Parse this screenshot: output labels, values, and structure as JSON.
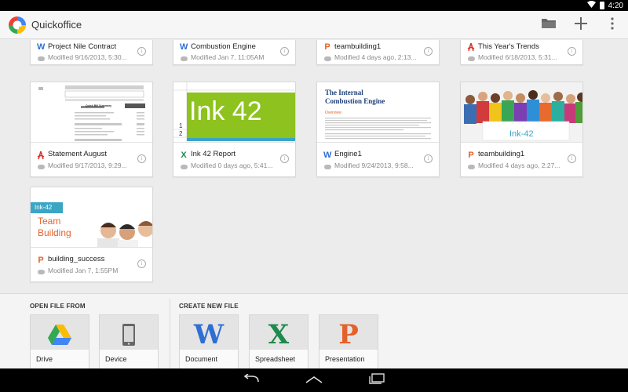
{
  "status": {
    "time": "4:20"
  },
  "app": {
    "title": "Quickoffice"
  },
  "files": [
    {
      "name": "Project Nile Contract",
      "modified": "Modified 9/16/2013, 5:30...",
      "type": "word",
      "glyph": "W"
    },
    {
      "name": "Combustion Engine",
      "modified": "Modified Jan 7, 11:05AM",
      "type": "word",
      "glyph": "W"
    },
    {
      "name": "teambuilding1",
      "modified": "Modified 4 days ago, 2:13...",
      "type": "slides",
      "glyph": "P"
    },
    {
      "name": "This Year's Trends",
      "modified": "Modified 6/18/2013, 5:31...",
      "type": "pdf",
      "glyph": "⅄"
    },
    {
      "name": "Statement August",
      "modified": "Modified 9/17/2013, 9:29...",
      "type": "pdf",
      "glyph": "⅄"
    },
    {
      "name": "Ink 42 Report",
      "modified": "Modified 0 days ago, 5:41...",
      "type": "sheet",
      "glyph": "X"
    },
    {
      "name": "Engine1",
      "modified": "Modified 9/24/2013, 9:58...",
      "type": "word",
      "glyph": "W"
    },
    {
      "name": "teambuilding1",
      "modified": "Modified 4 days ago, 2:27...",
      "type": "slides",
      "glyph": "P"
    },
    {
      "name": "building_success",
      "modified": "Modified Jan 7, 1:55PM",
      "type": "slides",
      "glyph": "P"
    }
  ],
  "thumbs": {
    "statement": {
      "title": "Quick Bill Summary"
    },
    "ink42": {
      "text": "Ink 42",
      "row1": "1",
      "row2": "2"
    },
    "engine": {
      "title_line1": "The Internal",
      "title_line2": "Combustion Engine",
      "section": "Overview"
    },
    "teambuilding": {
      "banner": "Ink-42"
    },
    "building_success": {
      "tag": "Ink-42",
      "line1": "Team",
      "line2": "Building"
    }
  },
  "open_from": {
    "label": "OPEN FILE FROM",
    "items": [
      {
        "label": "Drive",
        "icon": "drive-icon"
      },
      {
        "label": "Device",
        "icon": "device-icon"
      }
    ]
  },
  "create_new": {
    "label": "CREATE NEW FILE",
    "items": [
      {
        "label": "Document",
        "glyph": "W",
        "icon": "document-icon"
      },
      {
        "label": "Spreadsheet",
        "glyph": "X",
        "icon": "spreadsheet-icon"
      },
      {
        "label": "Presentation",
        "glyph": "P",
        "icon": "presentation-icon"
      }
    ]
  },
  "colors": {
    "word": "#2f6fd4",
    "sheet": "#1f8a4c",
    "slides": "#e3622a",
    "pdf": "#d9312b",
    "ink_green": "#8dc21f",
    "ink_teal": "#3aa6c4"
  }
}
